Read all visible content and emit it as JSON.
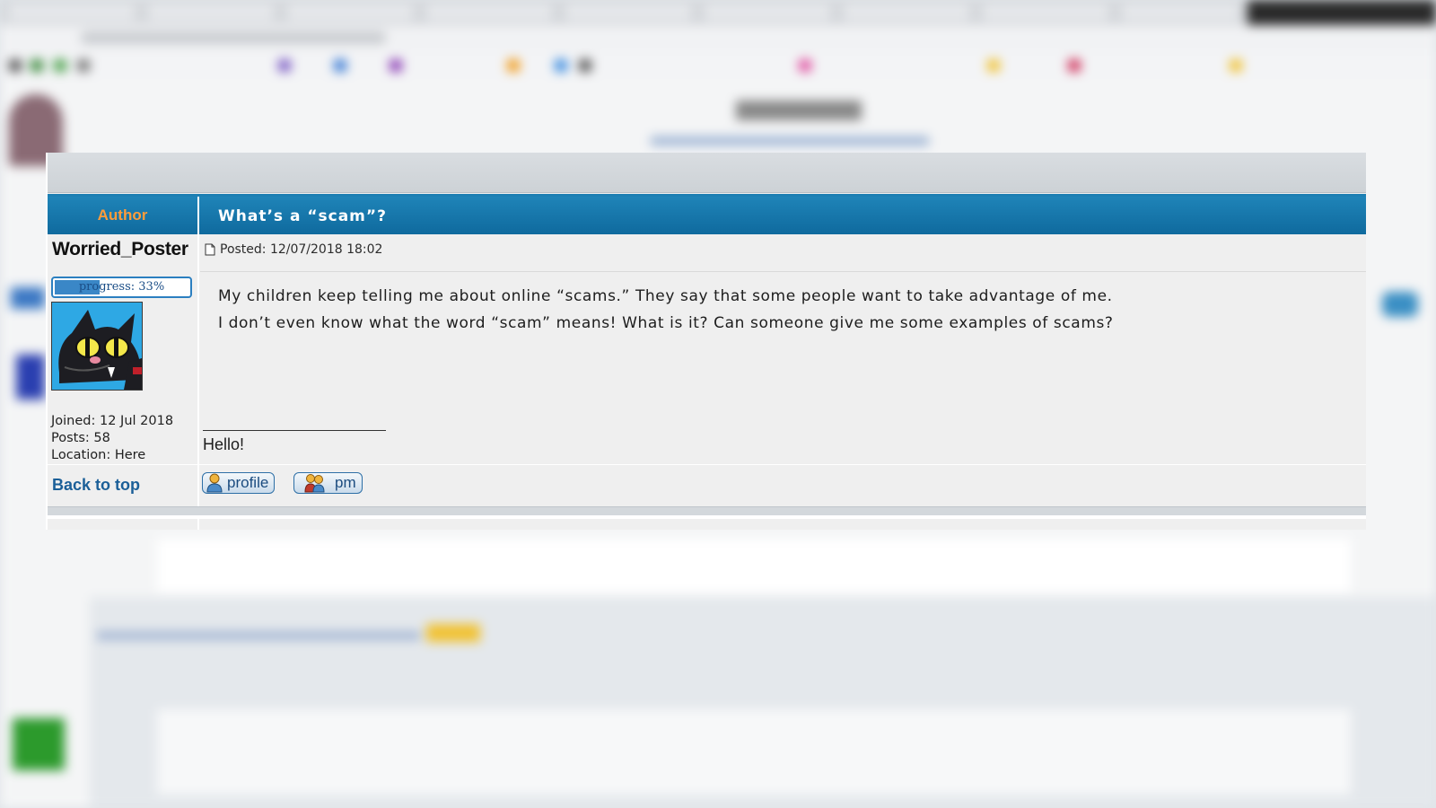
{
  "post": {
    "author_header": "Author",
    "title": "What’s a “scam”?",
    "posted_label": "Posted: 12/07/2018 18:02",
    "body_lines": [
      "My children keep telling me about online “scams.” They say that some people want to take advantage of me.",
      "I don’t even know what the word “scam” means! What is it? Can someone give me some examples of scams?"
    ],
    "signature": "Hello!"
  },
  "user": {
    "name": "Worried_Poster",
    "progress_label": "progress: 33%",
    "progress_value": 0.33,
    "joined": "Joined: 12 Jul 2018",
    "posts": "Posts: 58",
    "location": "Location: Here"
  },
  "actions": {
    "back_to_top": "Back to top",
    "profile": "profile",
    "pm": "pm"
  },
  "colors": {
    "header_blue": "#0f6a9e",
    "author_orange": "#ff9c3a",
    "link_blue": "#1b5f98"
  }
}
